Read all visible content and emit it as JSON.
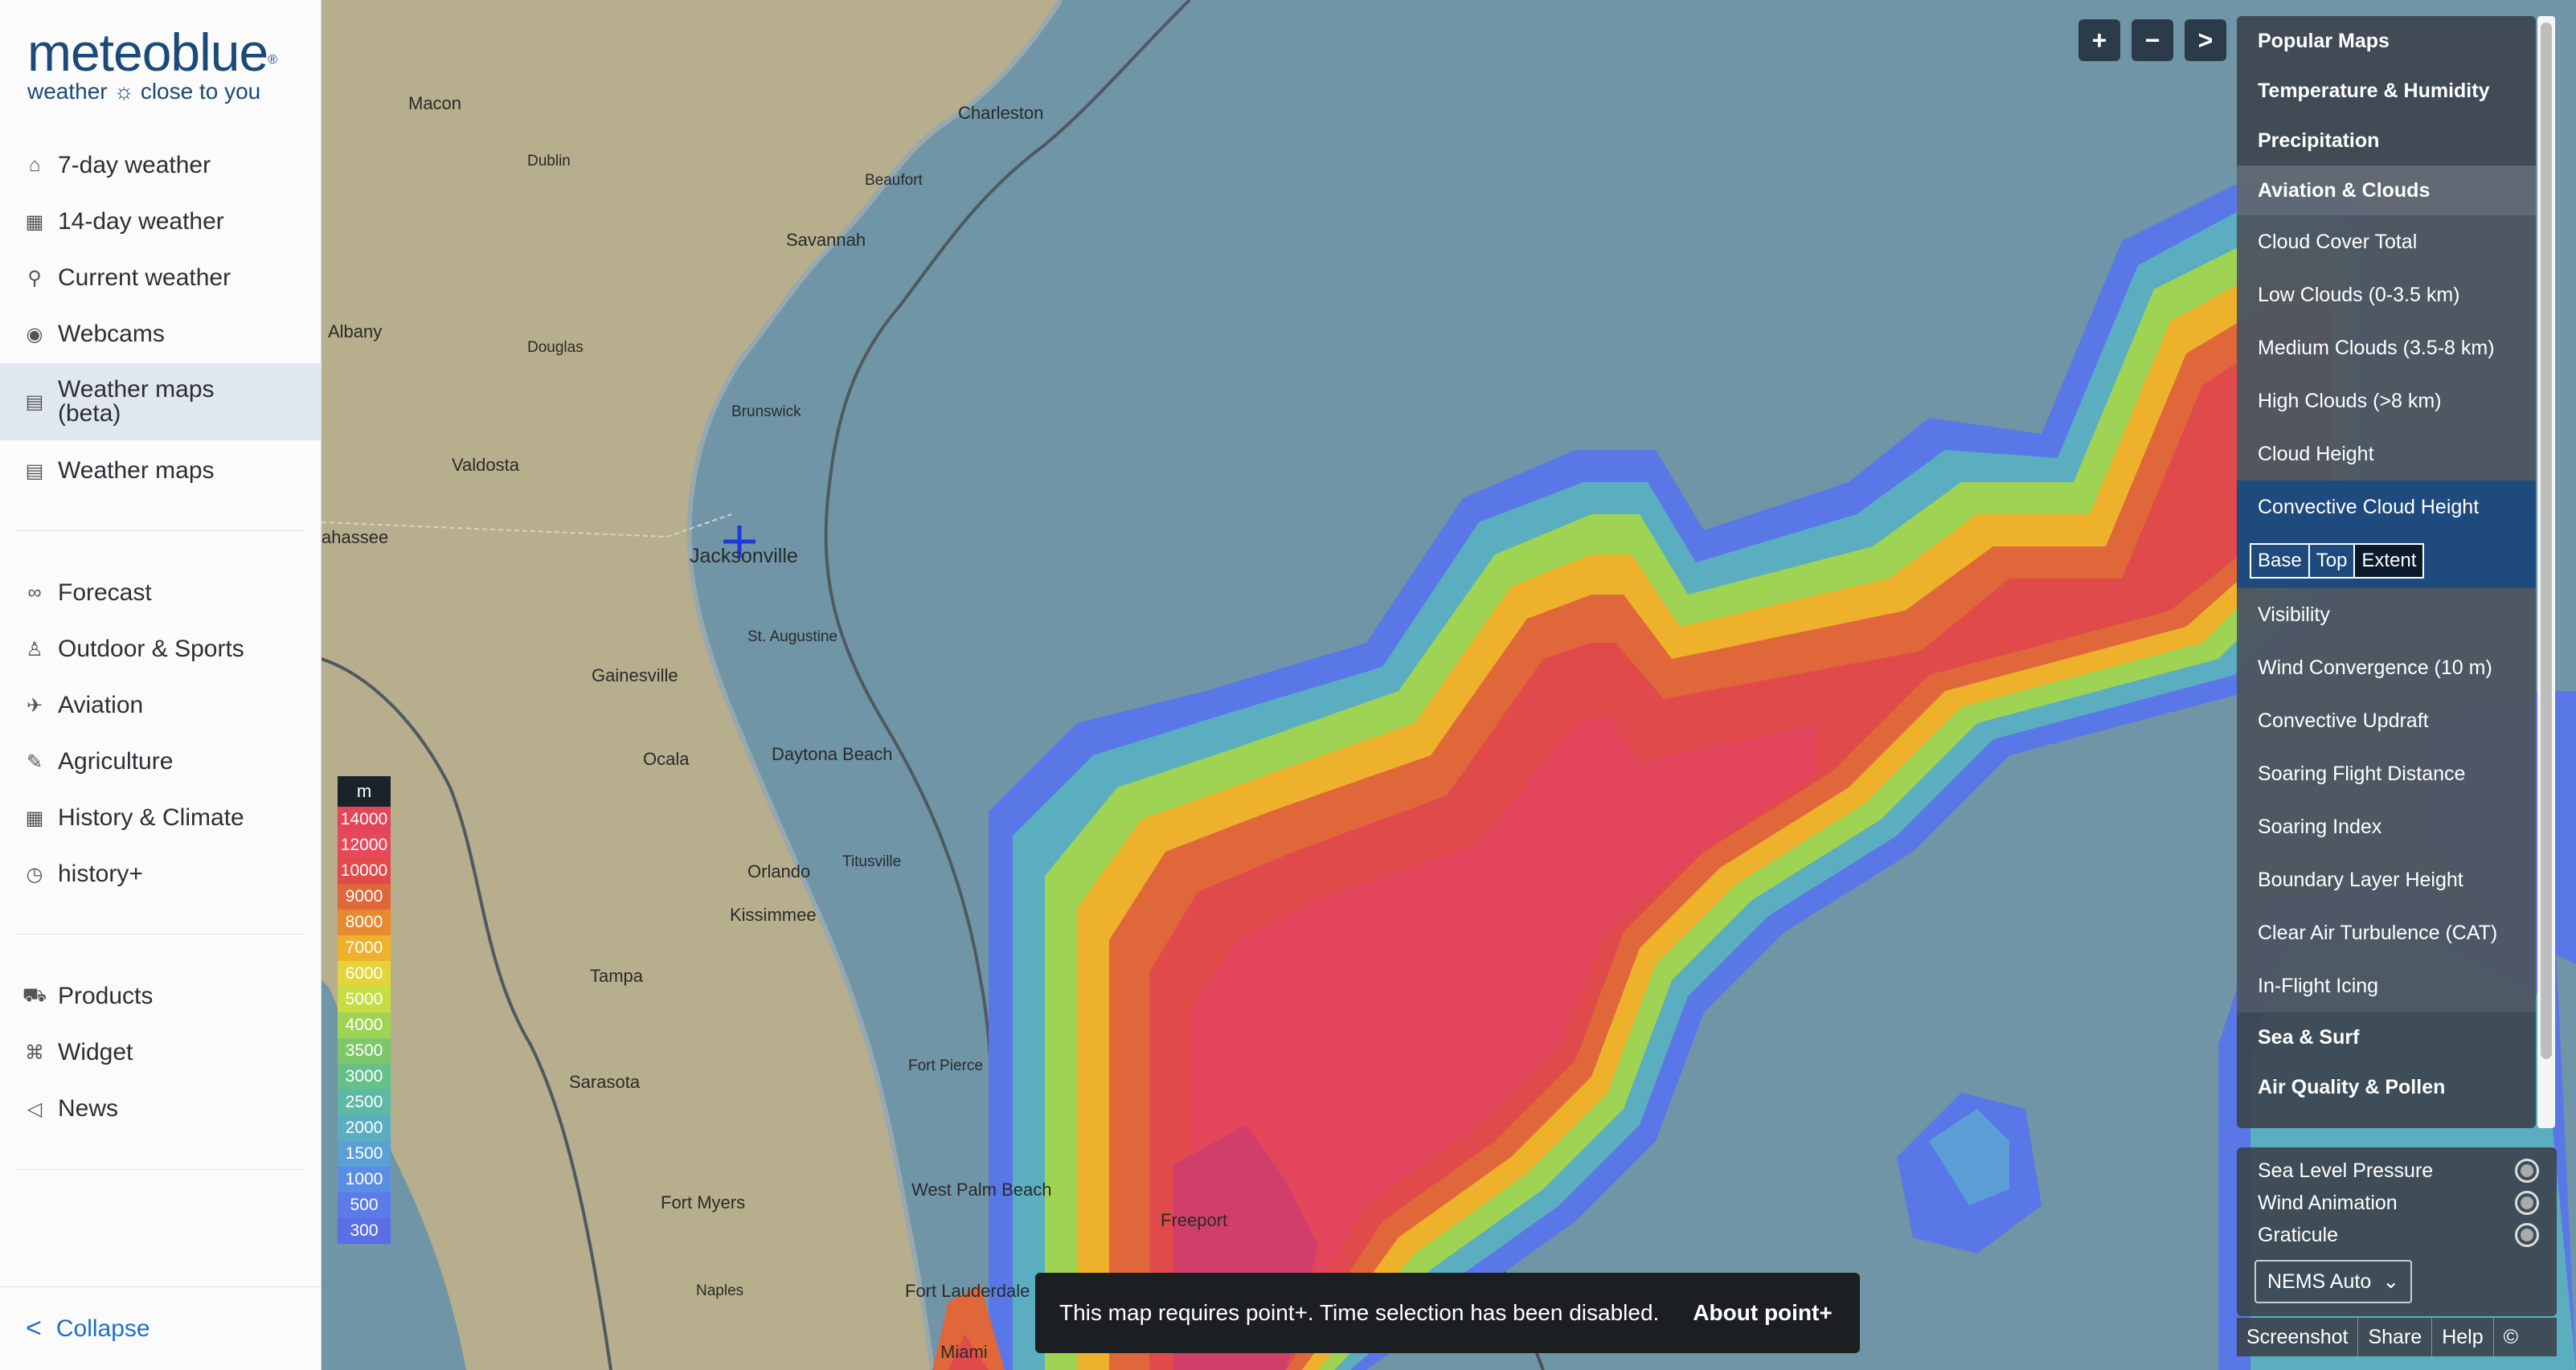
{
  "logo": {
    "word": "meteoblue",
    "reg": "®",
    "tagline": "weather ☼ close to you"
  },
  "nav": {
    "items": [
      {
        "label": "7-day weather",
        "icon": "home-icon"
      },
      {
        "label": "14-day weather",
        "icon": "calendar-icon"
      },
      {
        "label": "Current weather",
        "icon": "satellite-icon"
      },
      {
        "label": "Webcams",
        "icon": "webcam-icon"
      },
      {
        "label": "Weather maps (beta)",
        "icon": "map-icon",
        "active": true
      },
      {
        "label": "Weather maps",
        "icon": "map-icon"
      },
      {
        "label": "Forecast",
        "icon": "binoculars-icon"
      },
      {
        "label": "Outdoor & Sports",
        "icon": "hiker-icon"
      },
      {
        "label": "Aviation",
        "icon": "plane-icon"
      },
      {
        "label": "Agriculture",
        "icon": "pen-icon"
      },
      {
        "label": "History & Climate",
        "icon": "table-icon"
      },
      {
        "label": "history+",
        "icon": "history-icon"
      },
      {
        "label": "Products",
        "icon": "cart-icon"
      },
      {
        "label": "Widget",
        "icon": "widget-icon"
      },
      {
        "label": "News",
        "icon": "megaphone-icon"
      }
    ],
    "collapse": "Collapse"
  },
  "map": {
    "cities": [
      "Macon",
      "Charleston",
      "Dublin",
      "Beaufort",
      "Savannah",
      "Albany",
      "Douglas",
      "Brunswick",
      "Valdosta",
      "ahassee",
      "Jacksonville",
      "St. Augustine",
      "Gainesville",
      "Ocala",
      "Daytona Beach",
      "Orlando",
      "Titusville",
      "Kissimmee",
      "Tampa",
      "Sarasota",
      "Fort Pierce",
      "West Palm Beach",
      "Freeport",
      "Fort Myers",
      "Naples",
      "Fort Lauderdale",
      "Miami"
    ],
    "legend": {
      "unit": "m",
      "entries": [
        {
          "value": "14000",
          "color": "#e2455c"
        },
        {
          "value": "12000",
          "color": "#e5495a"
        },
        {
          "value": "10000",
          "color": "#e14a4a"
        },
        {
          "value": "9000",
          "color": "#e0673a"
        },
        {
          "value": "8000",
          "color": "#e8892f"
        },
        {
          "value": "7000",
          "color": "#eeb12c"
        },
        {
          "value": "6000",
          "color": "#e2d43a"
        },
        {
          "value": "5000",
          "color": "#c6dd45"
        },
        {
          "value": "4000",
          "color": "#9fd354"
        },
        {
          "value": "3500",
          "color": "#7dc76b"
        },
        {
          "value": "3000",
          "color": "#65c08a"
        },
        {
          "value": "2500",
          "color": "#5db8a5"
        },
        {
          "value": "2000",
          "color": "#5aaec0"
        },
        {
          "value": "1500",
          "color": "#5b9fd6"
        },
        {
          "value": "1000",
          "color": "#5a8ee4"
        },
        {
          "value": "500",
          "color": "#5b7ce8"
        },
        {
          "value": "300",
          "color": "#5a6ee8"
        }
      ]
    }
  },
  "controls": {
    "zoom_in": "+",
    "zoom_out": "−",
    "next": ">"
  },
  "panel": {
    "groups": [
      "Popular Maps",
      "Temperature & Humidity",
      "Precipitation",
      "Aviation & Clouds"
    ],
    "items": [
      "Cloud Cover Total",
      "Low Clouds (0-3.5 km)",
      "Medium Clouds (3.5-8 km)",
      "High Clouds (>8 km)",
      "Cloud Height",
      "Convective Cloud Height"
    ],
    "segments": [
      "Base",
      "Top",
      "Extent"
    ],
    "items2": [
      "Visibility",
      "Wind Convergence (10 m)",
      "Convective Updraft",
      "Soaring Flight Distance",
      "Soaring Index",
      "Boundary Layer Height",
      "Clear Air Turbulence (CAT)",
      "In-Flight Icing"
    ],
    "groups2": [
      "Sea & Surf",
      "Air Quality & Pollen"
    ]
  },
  "options": {
    "toggles": [
      "Sea Level Pressure",
      "Wind Animation",
      "Graticule"
    ],
    "model": "NEMS Auto",
    "bottom": [
      "Screenshot",
      "Share",
      "Help",
      "©"
    ]
  },
  "banner": {
    "message": "This map requires point+. Time selection has been disabled.",
    "link": "About point+"
  }
}
